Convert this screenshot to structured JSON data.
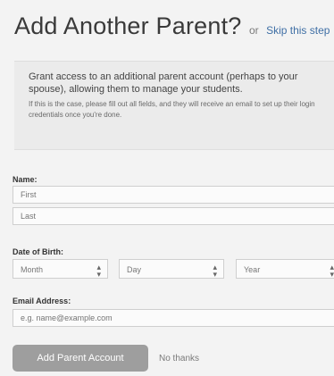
{
  "header": {
    "title": "Add Another Parent?",
    "or_text": "or",
    "skip_link": "Skip this step"
  },
  "info": {
    "lead": "Grant access to an additional parent account (perhaps to your spouse), allowing them to manage your students.",
    "fine_print": "If this is the case, please fill out all fields, and they will receive an email to set up their login credentials once you're done."
  },
  "form": {
    "name_label": "Name:",
    "first_placeholder": "First",
    "last_placeholder": "Last",
    "dob_label": "Date of Birth:",
    "month_label": "Month",
    "day_label": "Day",
    "year_label": "Year",
    "email_label": "Email Address:",
    "email_placeholder": "e.g. name@example.com"
  },
  "actions": {
    "add_button": "Add Parent Account",
    "no_thanks": "No thanks"
  }
}
